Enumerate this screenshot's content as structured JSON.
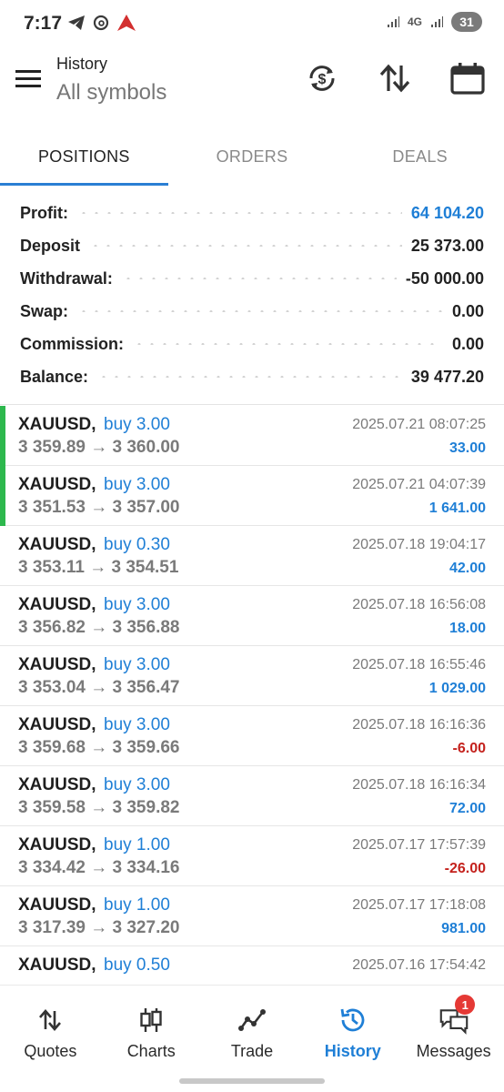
{
  "status_bar": {
    "time": "7:17",
    "network": "4G",
    "battery": "31"
  },
  "header": {
    "title": "History",
    "subtitle": "All symbols"
  },
  "tabs": [
    {
      "label": "POSITIONS",
      "active": true
    },
    {
      "label": "ORDERS",
      "active": false
    },
    {
      "label": "DEALS",
      "active": false
    }
  ],
  "summary": {
    "rows": [
      {
        "label": "Profit:",
        "value": "64 104.20"
      },
      {
        "label": "Deposit",
        "value": "25 373.00"
      },
      {
        "label": "Withdrawal:",
        "value": "-50 000.00"
      },
      {
        "label": "Swap:",
        "value": "0.00"
      },
      {
        "label": "Commission:",
        "value": "0.00"
      },
      {
        "label": "Balance:",
        "value": "39 477.20"
      }
    ]
  },
  "deals": [
    {
      "symbol": "XAUUSD,",
      "side": "buy 3.00",
      "prices": "3 359.89 → 3 360.00",
      "time": "2025.07.21 08:07:25",
      "profit": "33.00"
    },
    {
      "symbol": "XAUUSD,",
      "side": "buy 3.00",
      "prices": "3 351.53 → 3 357.00",
      "time": "2025.07.21 04:07:39",
      "profit": "1 641.00"
    },
    {
      "symbol": "XAUUSD,",
      "side": "buy 0.30",
      "prices": "3 353.11 → 3 354.51",
      "time": "2025.07.18 19:04:17",
      "profit": "42.00"
    },
    {
      "symbol": "XAUUSD,",
      "side": "buy 3.00",
      "prices": "3 356.82 → 3 356.88",
      "time": "2025.07.18 16:56:08",
      "profit": "18.00"
    },
    {
      "symbol": "XAUUSD,",
      "side": "buy 3.00",
      "prices": "3 353.04 → 3 356.47",
      "time": "2025.07.18 16:55:46",
      "profit": "1 029.00"
    },
    {
      "symbol": "XAUUSD,",
      "side": "buy 3.00",
      "prices": "3 359.68 → 3 359.66",
      "time": "2025.07.18 16:16:36",
      "profit": "-6.00"
    },
    {
      "symbol": "XAUUSD,",
      "side": "buy 3.00",
      "prices": "3 359.58 → 3 359.82",
      "time": "2025.07.18 16:16:34",
      "profit": "72.00"
    },
    {
      "symbol": "XAUUSD,",
      "side": "buy 1.00",
      "prices": "3 334.42 → 3 334.16",
      "time": "2025.07.17 17:57:39",
      "profit": "-26.00"
    },
    {
      "symbol": "XAUUSD,",
      "side": "buy 1.00",
      "prices": "3 317.39 → 3 327.20",
      "time": "2025.07.17 17:18:08",
      "profit": "981.00"
    },
    {
      "symbol": "XAUUSD,",
      "side": "buy 0.50",
      "prices": "",
      "time": "2025.07.16 17:54:42",
      "profit": ""
    }
  ],
  "bottom_nav": [
    {
      "label": "Quotes",
      "icon": "quotes-icon"
    },
    {
      "label": "Charts",
      "icon": "candlestick-icon"
    },
    {
      "label": "Trade",
      "icon": "trade-line-icon"
    },
    {
      "label": "History",
      "icon": "history-clock-icon",
      "active": true
    },
    {
      "label": "Messages",
      "icon": "messages-icon",
      "badge": "1"
    }
  ],
  "colors": {
    "accent": "#1f7fd6",
    "loss": "#c4221d",
    "marker": "#2db84d"
  }
}
